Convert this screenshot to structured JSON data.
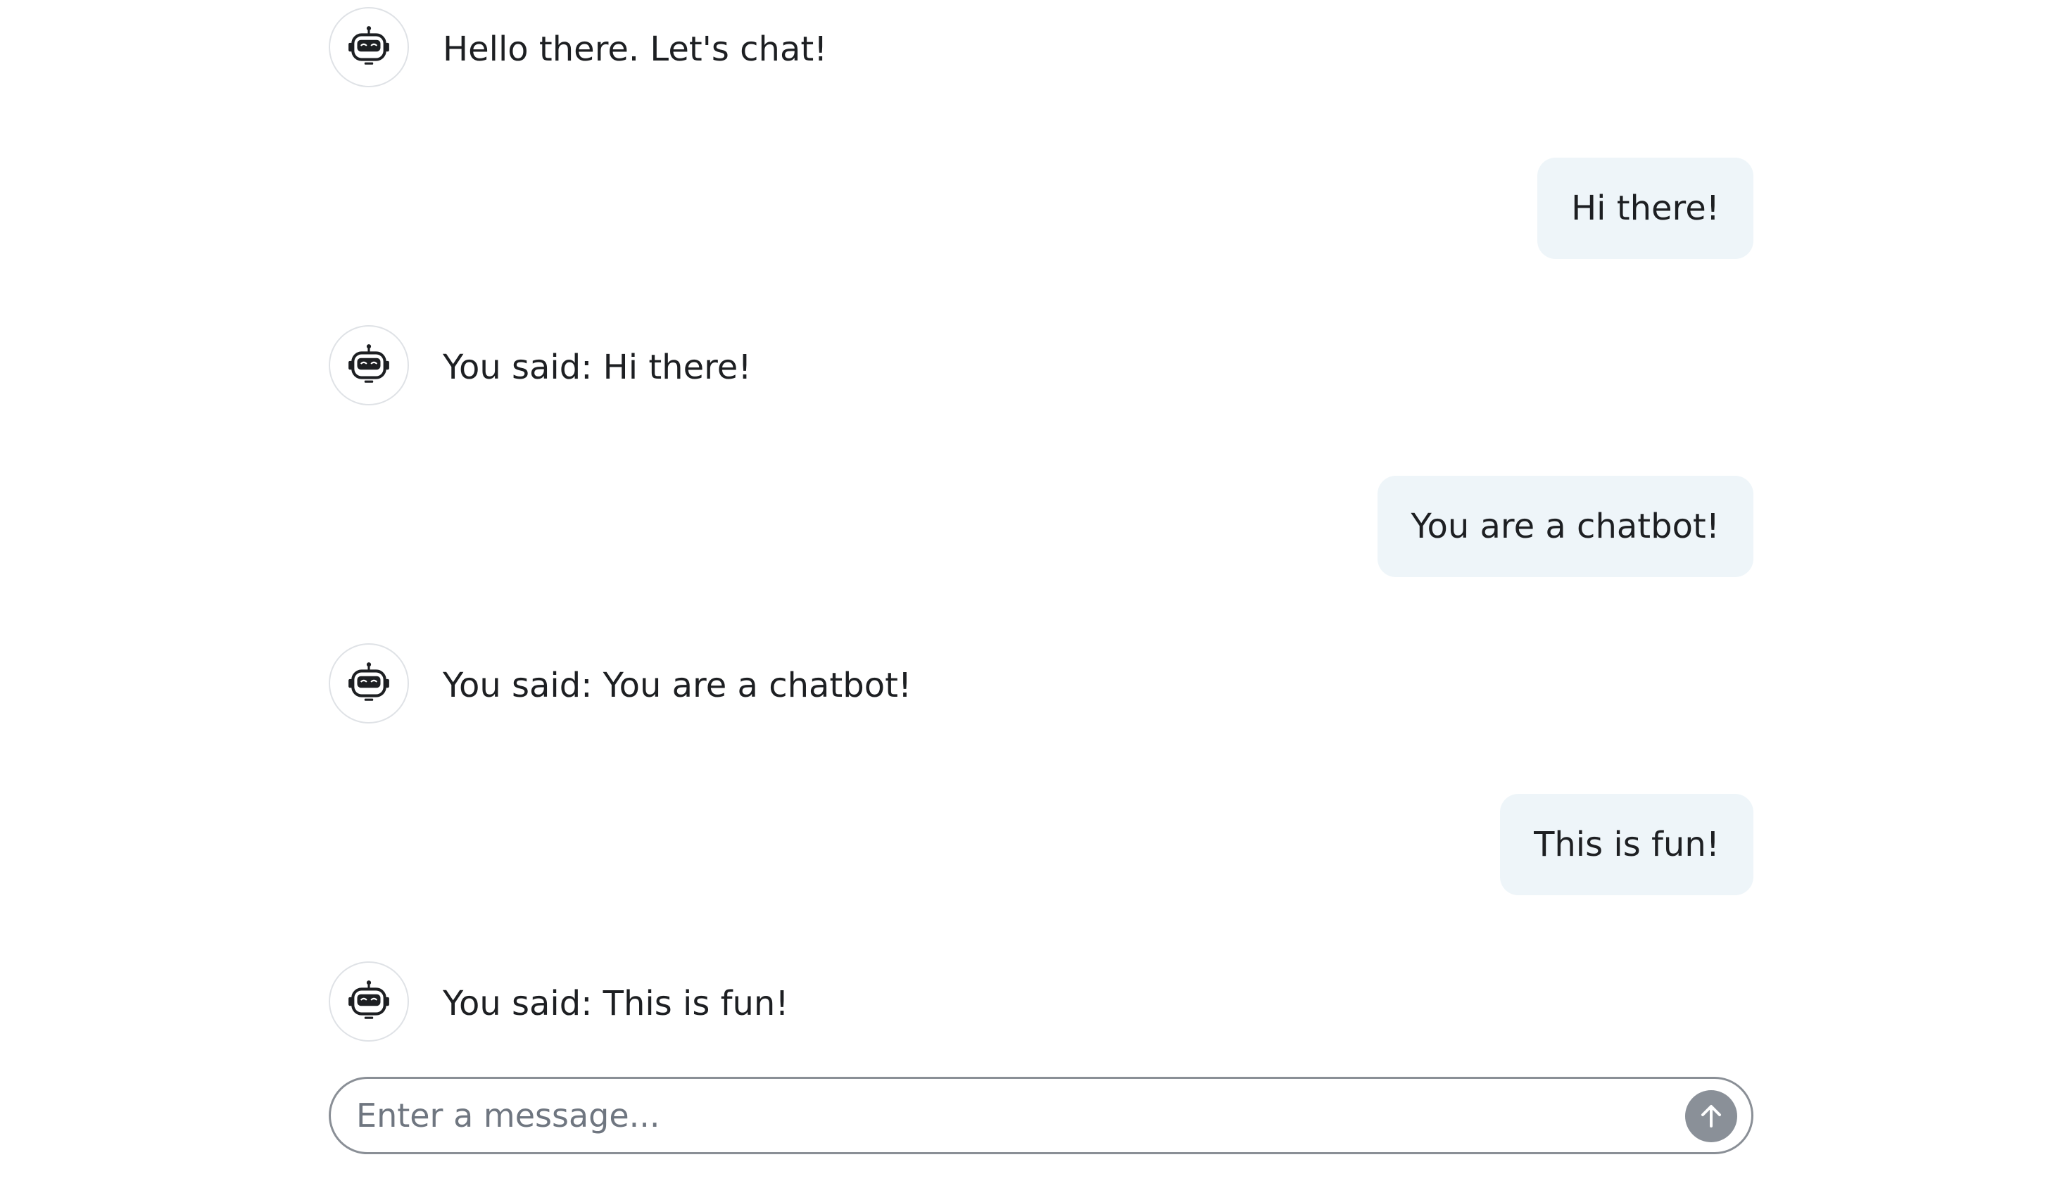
{
  "messages": [
    {
      "role": "bot",
      "text": "Hello there. Let's chat!"
    },
    {
      "role": "user",
      "text": "Hi there!"
    },
    {
      "role": "bot",
      "text": "You said: Hi there!"
    },
    {
      "role": "user",
      "text": "You are a chatbot!"
    },
    {
      "role": "bot",
      "text": "You said: You are a chatbot!"
    },
    {
      "role": "user",
      "text": "This is fun!"
    },
    {
      "role": "bot",
      "text": "You said: This is fun!"
    }
  ],
  "composer": {
    "placeholder": "Enter a message...",
    "value": "",
    "send_icon": "arrow-up-icon"
  },
  "avatar": {
    "icon": "robot-icon"
  },
  "colors": {
    "user_bubble": "#eef5f9",
    "send_button": "#8a9098",
    "composer_border": "#8a8f96"
  }
}
